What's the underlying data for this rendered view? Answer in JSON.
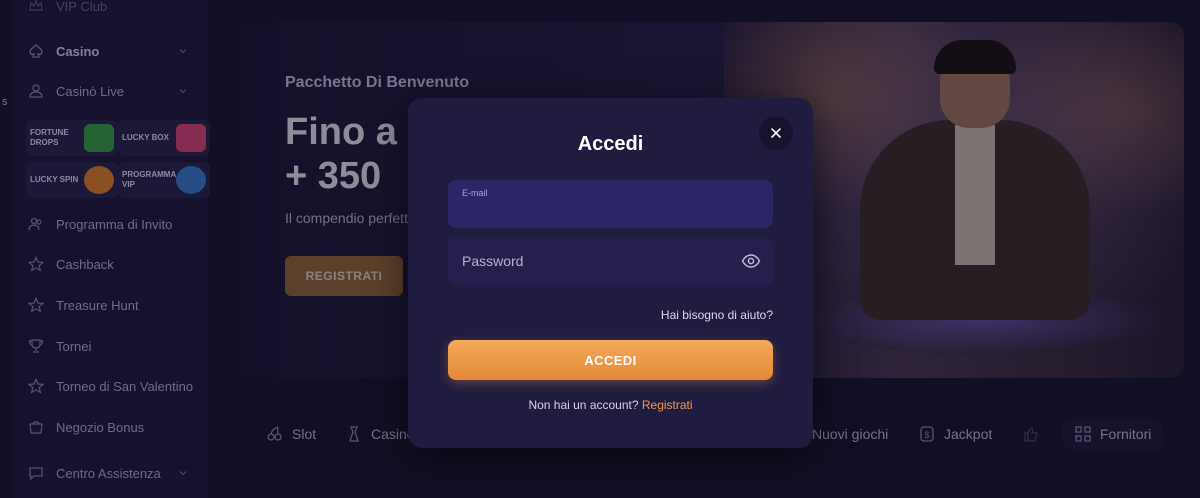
{
  "sidebar": {
    "top_partial": "VIP Club",
    "items": [
      {
        "label": "Casino",
        "icon": "club-icon",
        "expandable": true,
        "bold": true
      },
      {
        "label": "Casinò Live",
        "icon": "dealer-icon",
        "expandable": true,
        "bold": false
      },
      {
        "label": "Programma di Invito",
        "icon": "users-icon",
        "expandable": false,
        "bold": false
      },
      {
        "label": "Cashback",
        "icon": "star-icon",
        "expandable": false,
        "bold": false
      },
      {
        "label": "Treasure Hunt",
        "icon": "star-icon",
        "expandable": false,
        "bold": false
      },
      {
        "label": "Tornei",
        "icon": "trophy-icon",
        "expandable": false,
        "bold": false
      },
      {
        "label": "Torneo di San Valentino",
        "icon": "star-icon",
        "expandable": false,
        "bold": false
      },
      {
        "label": "Negozio Bonus",
        "icon": "shop-icon",
        "expandable": false,
        "bold": false
      },
      {
        "label": "Centro Assistenza",
        "icon": "chat-icon",
        "expandable": true,
        "bold": false
      }
    ],
    "promos": [
      {
        "label": "FORTUNE DROPS",
        "color": "#3aa54a"
      },
      {
        "label": "LUCKY BOX",
        "color": "#e0467a"
      },
      {
        "label": "LUCKY SPIN",
        "color": "#e8832e"
      },
      {
        "label": "PROGRAMMA VIP",
        "color": "#3a7fd0"
      }
    ],
    "edge_letter": "s"
  },
  "banner": {
    "eyebrow": "Pacchetto Di Benvenuto",
    "line1": "Fino a",
    "line2": "+ 350",
    "subtitle": "Il compendio perfetto",
    "cta": "REGISTRATI"
  },
  "categories": [
    {
      "label": "Slot",
      "icon": "slot-icon"
    },
    {
      "label": "Casinò Live",
      "icon": "dealer-icon"
    },
    {
      "label": "Nuovi giochi",
      "icon": "new-icon"
    },
    {
      "label": "Jackpot",
      "icon": "jackpot-icon"
    },
    {
      "label": "Fornitori",
      "icon": "grid-icon"
    }
  ],
  "login": {
    "title": "Accedi",
    "email_label": "E-mail",
    "email_value": "",
    "password_placeholder": "Password",
    "help": "Hai bisogno di aiuto?",
    "submit": "ACCEDI",
    "no_account": "Non hai un account?",
    "register": "Registrati"
  },
  "colors": {
    "accent": "#f39b45",
    "background": "#181530",
    "modal": "#201c40"
  }
}
